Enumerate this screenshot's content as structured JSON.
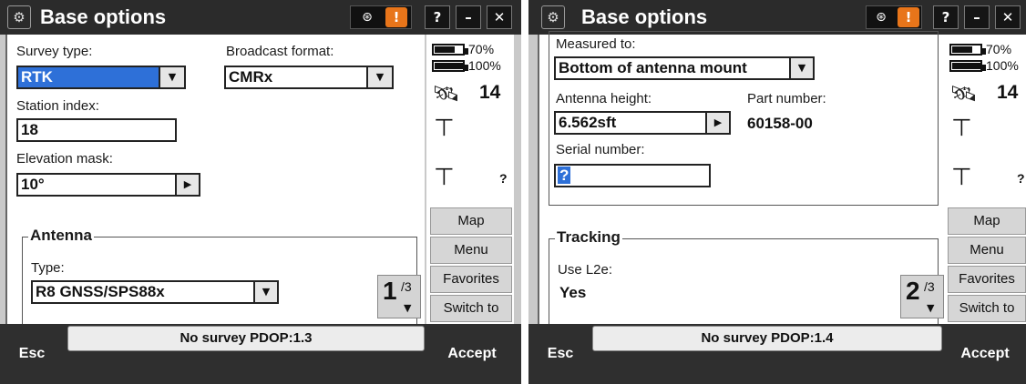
{
  "left": {
    "title": "Base options",
    "survey_type_label": "Survey type:",
    "survey_type_value": "RTK",
    "broadcast_label": "Broadcast format:",
    "broadcast_value": "CMRx",
    "station_index_label": "Station index:",
    "station_index_value": "18",
    "elevation_mask_label": "Elevation mask:",
    "elevation_mask_value": "10°",
    "antenna_group": "Antenna",
    "type_label": "Type:",
    "type_value": "R8 GNSS/SPS88x",
    "page_current": "1",
    "page_total": "/3",
    "status_text": "No survey  PDOP:1.3"
  },
  "right": {
    "title": "Base options",
    "measured_to_label": "Measured to:",
    "measured_to_value": "Bottom of antenna mount",
    "antenna_height_label": "Antenna height:",
    "antenna_height_value": "6.562sft",
    "part_number_label": "Part number:",
    "part_number_value": "60158-00",
    "serial_number_label": "Serial number:",
    "serial_number_value": "?",
    "tracking_group": "Tracking",
    "use_l2e_label": "Use L2e:",
    "use_l2e_value": "Yes",
    "page_current": "2",
    "page_total": "/3",
    "status_text": "No survey  PDOP:1.4"
  },
  "titlebar": {
    "help": "?",
    "minimize": "–",
    "close": "✕",
    "alert": "!"
  },
  "status": {
    "battery_1_pct": "70%",
    "battery_2_pct": "100%",
    "battery_1_level": 0.7,
    "battery_2_level": 1.0,
    "satellites": "14",
    "unknown": "?"
  },
  "side_buttons": {
    "map": "Map",
    "menu": "Menu",
    "favorites": "Favorites",
    "switch_to": "Switch to"
  },
  "buttons": {
    "esc": "Esc",
    "accept": "Accept"
  },
  "icons": {
    "logo": "settings-gear-icon",
    "receiver": "receiver-icon",
    "satellite": "satellite-icon",
    "antenna": "antenna-icon"
  },
  "colors": {
    "selection": "#2e70d8",
    "alert": "#e8751a",
    "titlebar": "#2b2b2b"
  }
}
